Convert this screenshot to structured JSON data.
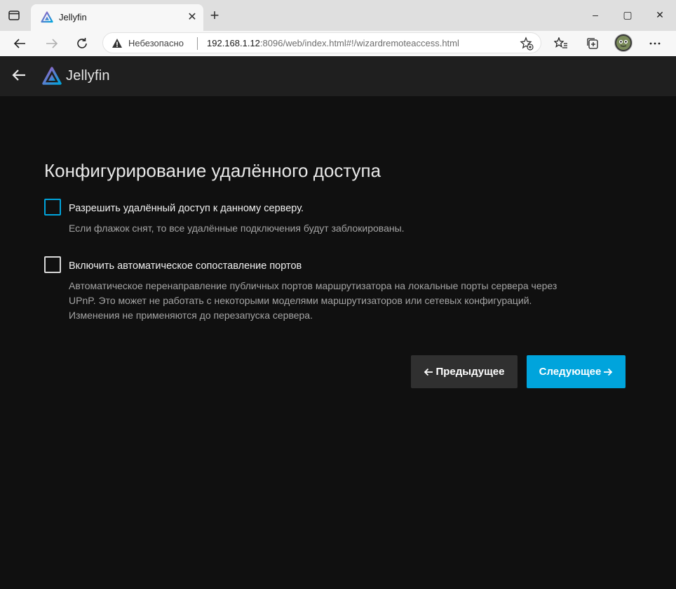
{
  "browser": {
    "tab_title": "Jellyfin",
    "tab_close": "✕",
    "new_tab": "+",
    "security_label": "Небезопасно",
    "url_host": "192.168.1.12",
    "url_port": ":8096",
    "url_path": "/web/index.html#!/wizardremoteaccess.html",
    "window_controls": [
      "–",
      "▢",
      "✕"
    ]
  },
  "app": {
    "brand": "Jellyfin"
  },
  "wizard": {
    "title": "Конфигурирование удалённого доступа",
    "options": [
      {
        "label": "Разрешить удалённый доступ к данному серверу.",
        "description": [
          "Если флажок снят, то все удалённые подключения будут заблокированы."
        ],
        "checked": false
      },
      {
        "label": "Включить автоматическое сопоставление портов",
        "description": [
          "Автоматическое перенаправление публичных портов маршрутизатора на локальные порты сервера через",
          "UPnP. Это может не работать с некоторыми моделями маршрутизаторов или сетевых конфигураций.",
          "Изменения не применяются до перезапуска сервера."
        ],
        "checked": false
      }
    ],
    "prev_label": "Предыдущее",
    "next_label": "Следующее"
  },
  "colors": {
    "accent": "#00a4dc",
    "background": "#101010",
    "header": "#1f1f1f"
  }
}
